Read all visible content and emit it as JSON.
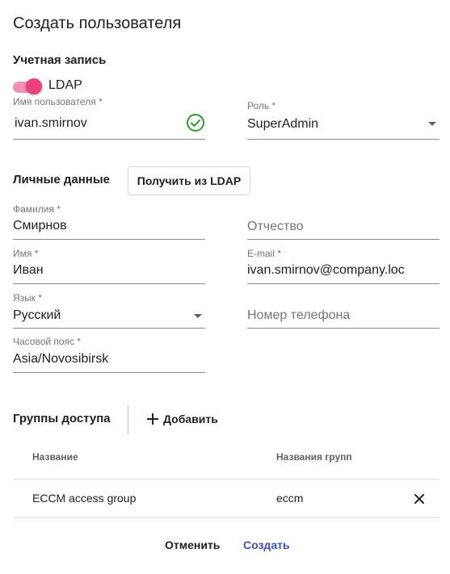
{
  "dialog": {
    "title": "Создать пользователя"
  },
  "account": {
    "section_title": "Учетная запись",
    "ldap_toggle": {
      "label": "LDAP",
      "on": true
    },
    "username": {
      "label": "Имя пользователя *",
      "value": "ivan.smirnov",
      "status_icon": "check-circle-icon"
    },
    "role": {
      "label": "Роль *",
      "value": "SuperAdmin"
    }
  },
  "personal": {
    "section_title": "Личные данные",
    "fetch_ldap_button": "Получить из LDAP",
    "last_name": {
      "label": "Фамилия *",
      "value": "Смирнов"
    },
    "middle_name": {
      "placeholder": "Отчество"
    },
    "first_name": {
      "label": "Имя *",
      "value": "Иван"
    },
    "email": {
      "label": "E-mail *",
      "value": "ivan.smirnov@company.loc"
    },
    "language": {
      "label": "Язык *",
      "value": "Русский"
    },
    "phone": {
      "placeholder": "Номер телефона"
    },
    "timezone": {
      "label": "Часовой пояс *",
      "value": "Asia/Novosibirsk"
    }
  },
  "groups": {
    "section_title": "Группы доступа",
    "add_button": "Добавить",
    "columns": {
      "name": "Название",
      "group_names": "Названия групп"
    },
    "rows": [
      {
        "name": "ECCM access group",
        "group_names": "eccm"
      }
    ]
  },
  "footer": {
    "cancel": "Отменить",
    "create": "Создать"
  },
  "colors": {
    "accent": "#ec407a",
    "accent_light": "#f48fb1",
    "success": "#2e9b2e",
    "link": "#3f51b5"
  }
}
